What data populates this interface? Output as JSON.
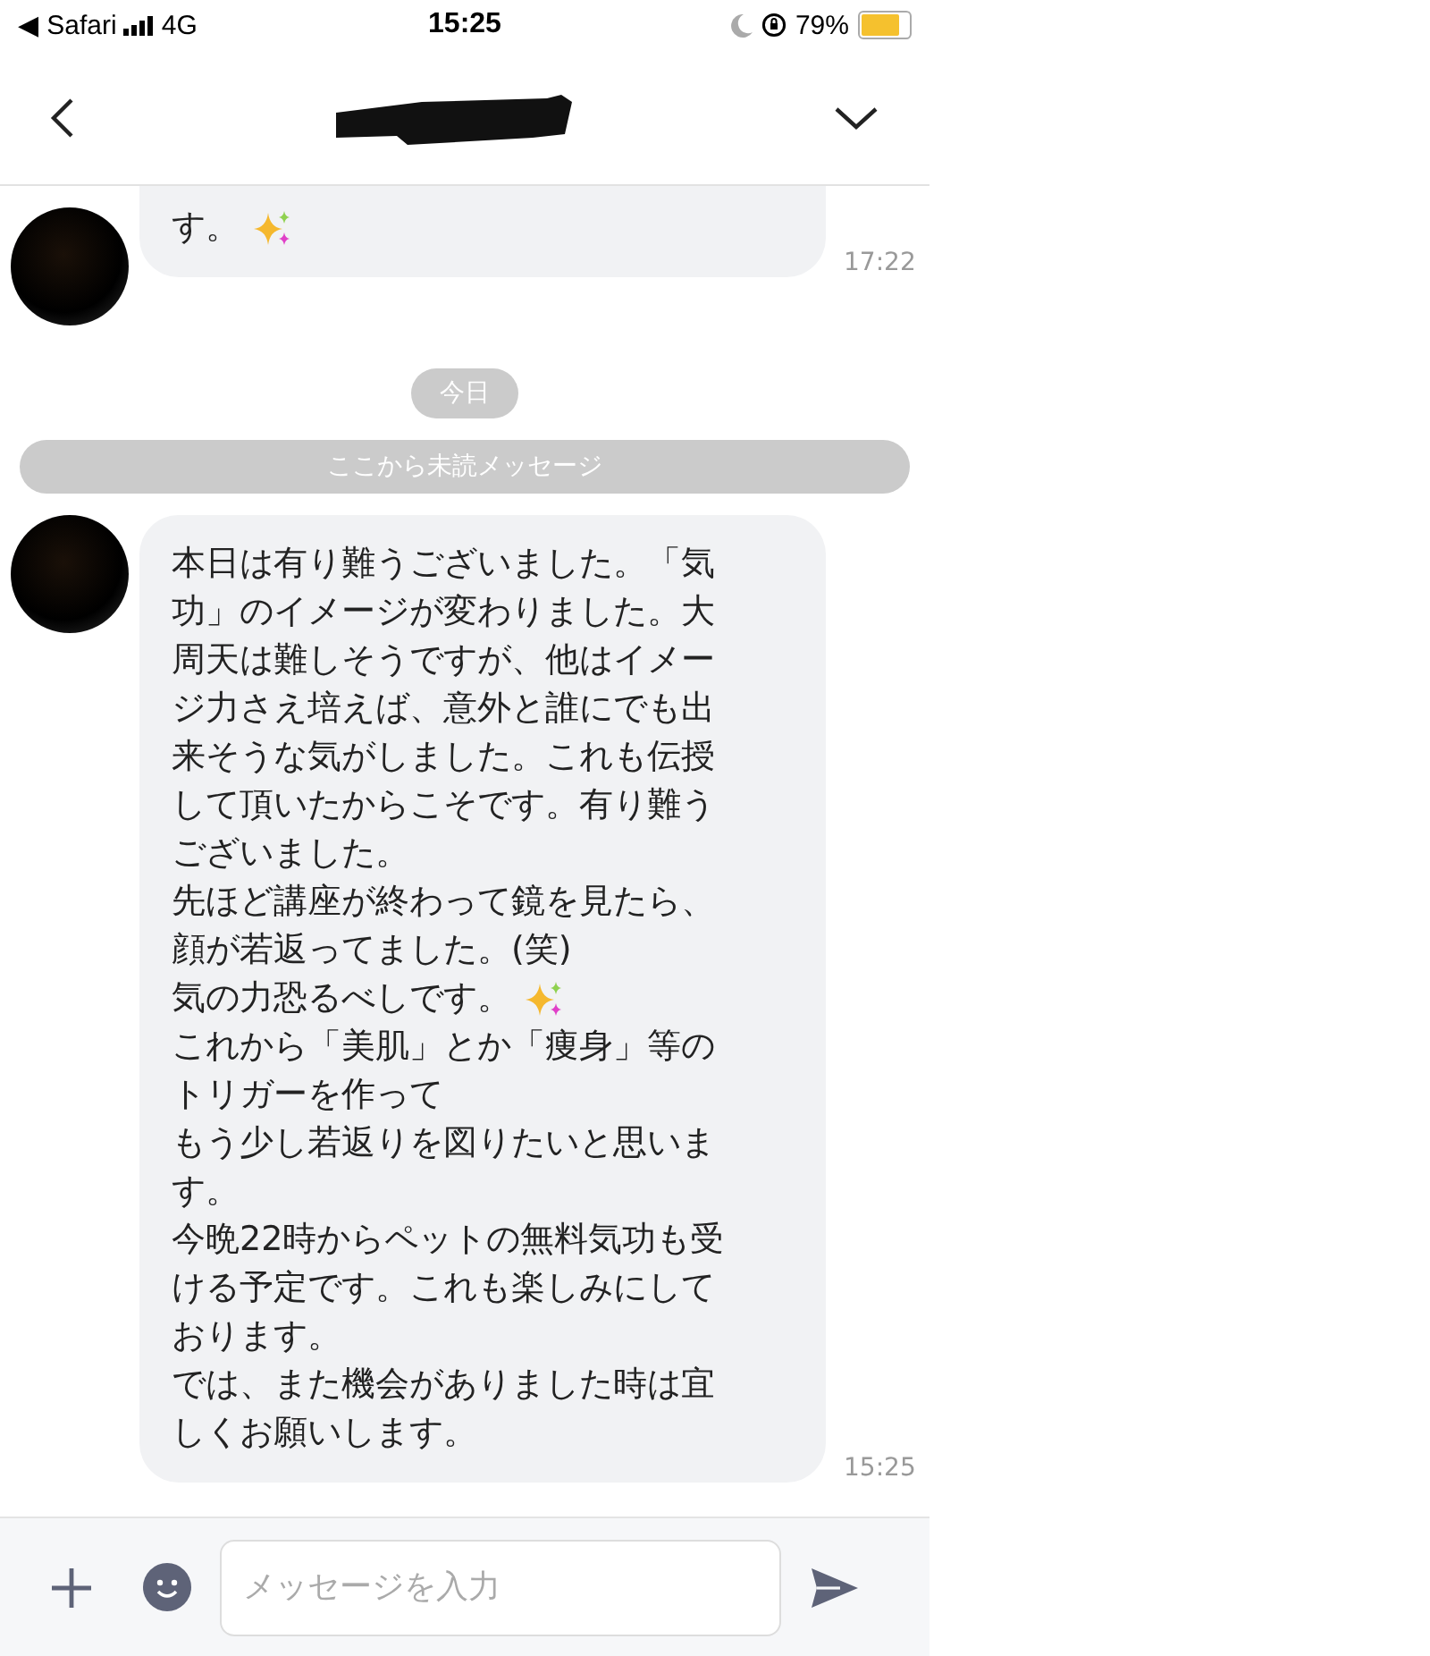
{
  "status_bar": {
    "back_app": "◀ Safari",
    "network": "4G",
    "time": "15:25",
    "battery": "79%"
  },
  "messages": [
    {
      "lines": [
        {
          "text": "す。",
          "sparkle": true
        }
      ],
      "time": "17:22"
    }
  ],
  "date_separator": "今日",
  "unread_marker": "ここから未読メッセージ",
  "messages_after": [
    {
      "lines": [
        {
          "text": "本日は有り難うございました。「気"
        },
        {
          "text": "功」のイメージが変わりました。大"
        },
        {
          "text": "周天は難しそうですが、他はイメー"
        },
        {
          "text": "ジ力さえ培えば、意外と誰にでも出"
        },
        {
          "text": "来そうな気がしました。これも伝授"
        },
        {
          "text": "して頂いたからこそです。有り難う"
        },
        {
          "text": "ございました。"
        },
        {
          "text": "先ほど講座が終わって鏡を見たら、"
        },
        {
          "text": "顔が若返ってました。(笑)"
        },
        {
          "text": "気の力恐るべしです。",
          "sparkle": true
        },
        {
          "text": "これから「美肌」とか「痩身」等の"
        },
        {
          "text": "トリガーを作って"
        },
        {
          "text": "もう少し若返りを図りたいと思いま"
        },
        {
          "text": "す。"
        },
        {
          "text": "今晩22時からペットの無料気功も受"
        },
        {
          "text": "ける予定です。これも楽しみにして"
        },
        {
          "text": "おります。"
        },
        {
          "text": "では、また機会がありました時は宜"
        },
        {
          "text": "しくお願いします。"
        }
      ],
      "time": "15:25"
    }
  ],
  "composer": {
    "placeholder": "メッセージを入力"
  }
}
